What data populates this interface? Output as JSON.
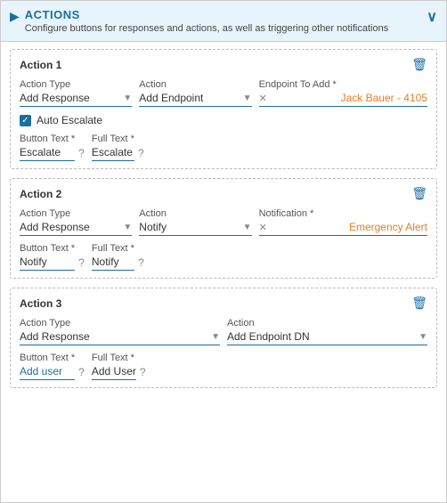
{
  "header": {
    "title": "ACTIONS",
    "subtitle": "Configure buttons for responses and actions, as well as triggering other notifications",
    "chevron_label": "▶",
    "collapse_label": "∨"
  },
  "actions": [
    {
      "id": "action1",
      "title": "Action 1",
      "action_type_label": "Action Type",
      "action_type_value": "Add Response",
      "action_label": "Action",
      "action_value": "Add Endpoint",
      "endpoint_label": "Endpoint To Add *",
      "endpoint_value": "Jack Bauer - 4105",
      "auto_escalate": true,
      "auto_escalate_label": "Auto Escalate",
      "button_text_label": "Button Text *",
      "button_text_value": "Escalate",
      "full_text_label": "Full Text *",
      "full_text_value": "Escalate",
      "has_endpoint": true,
      "has_notification": false
    },
    {
      "id": "action2",
      "title": "Action 2",
      "action_type_label": "Action Type",
      "action_type_value": "Add Response",
      "action_label": "Action",
      "action_value": "Notify",
      "notification_label": "Notification *",
      "notification_value": "Emergency Alert",
      "auto_escalate": false,
      "button_text_label": "Button Text *",
      "button_text_value": "Notify",
      "full_text_label": "Full Text *",
      "full_text_value": "Notify",
      "has_endpoint": false,
      "has_notification": true
    },
    {
      "id": "action3",
      "title": "Action 3",
      "action_type_label": "Action Type",
      "action_type_value": "Add Response",
      "action_label": "Action",
      "action_value": "Add Endpoint DN",
      "auto_escalate": false,
      "button_text_label": "Button Text *",
      "button_text_value": "Add user",
      "full_text_label": "Full Text *",
      "full_text_value": "Add User",
      "has_endpoint": false,
      "has_notification": false,
      "button_text_color": "blue",
      "full_text_color": "normal"
    }
  ]
}
